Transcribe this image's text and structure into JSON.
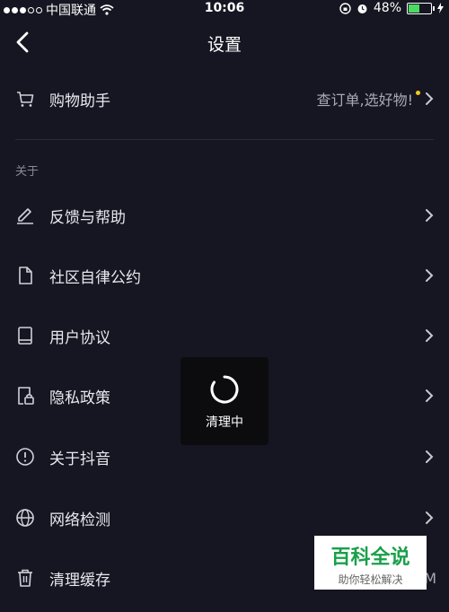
{
  "status_bar": {
    "carrier": "中国联通",
    "time": "10:06",
    "battery": "48%",
    "battery_level": 0.48
  },
  "nav": {
    "title": "设置"
  },
  "shopping": {
    "label": "购物助手",
    "hint": "查订单,选好物!"
  },
  "section_title": "关于",
  "items": [
    {
      "label": "反馈与帮助",
      "icon": "pencil-icon"
    },
    {
      "label": "社区自律公约",
      "icon": "document-icon"
    },
    {
      "label": "用户协议",
      "icon": "book-icon"
    },
    {
      "label": "隐私政策",
      "icon": "lock-file-icon"
    },
    {
      "label": "关于抖音",
      "icon": "info-circle-icon"
    },
    {
      "label": "网络检测",
      "icon": "globe-icon"
    },
    {
      "label": "清理缓存",
      "icon": "trash-icon"
    }
  ],
  "cache_size": "M",
  "toast": {
    "text": "清理中"
  },
  "watermark": {
    "title": "百科全说",
    "subtitle": "助你轻松解决"
  },
  "colors": {
    "background": "#161622",
    "accent": "#f7c51e",
    "watermark": "#1aa04a"
  }
}
